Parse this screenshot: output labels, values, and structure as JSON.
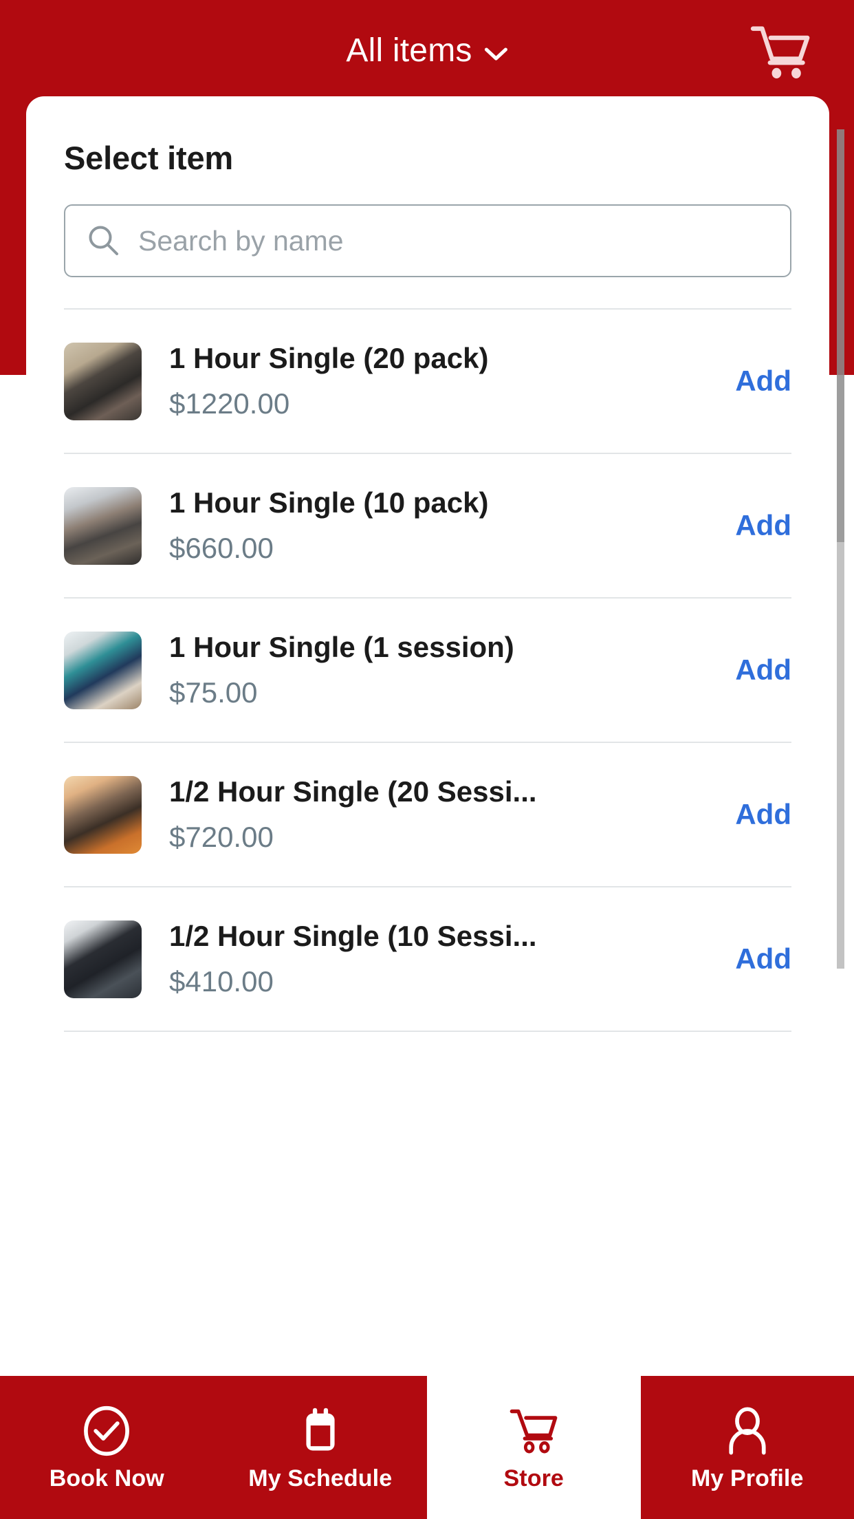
{
  "header": {
    "title": "All items",
    "dropdown_icon": "chevron-down-icon",
    "cart_icon": "shopping-cart-icon"
  },
  "panel": {
    "title": "Select item"
  },
  "search": {
    "placeholder": "Search by name",
    "value": "",
    "icon": "search-icon"
  },
  "items": [
    {
      "name": "1 Hour Single (20 pack)",
      "price": "$1220.00",
      "action": "Add"
    },
    {
      "name": "1 Hour Single (10 pack)",
      "price": "$660.00",
      "action": "Add"
    },
    {
      "name": "1 Hour Single (1 session)",
      "price": "$75.00",
      "action": "Add"
    },
    {
      "name": "1/2 Hour Single (20 Sessi...",
      "price": "$720.00",
      "action": "Add"
    },
    {
      "name": "1/2 Hour Single (10 Sessi...",
      "price": "$410.00",
      "action": "Add"
    }
  ],
  "bottom_nav": [
    {
      "label": "Book Now",
      "icon": "check-circle-icon",
      "active": false
    },
    {
      "label": "My Schedule",
      "icon": "calendar-icon",
      "active": false
    },
    {
      "label": "Store",
      "icon": "shopping-cart-icon",
      "active": true
    },
    {
      "label": "My Profile",
      "icon": "person-icon",
      "active": false
    }
  ],
  "colors": {
    "brand_red": "#b10a10",
    "add_link_blue": "#2f6edb",
    "price_gray": "#6b7c87",
    "title_dark": "#1b1b1b",
    "placeholder_gray": "#9aa2a8",
    "divider_gray": "#e2e5e7"
  }
}
